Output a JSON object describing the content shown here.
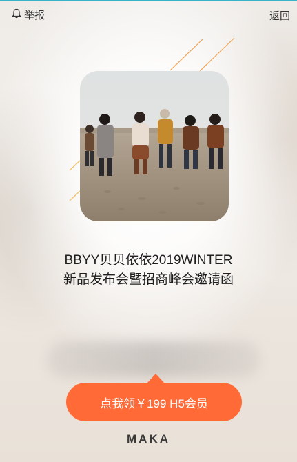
{
  "header": {
    "report_label": "举报",
    "back_label": "返回"
  },
  "content": {
    "title_line1": "BBYY贝贝依依2019WINTER",
    "title_line2": "新品发布会暨招商峰会邀请函"
  },
  "cta": {
    "label": "点我领￥199 H5会员"
  },
  "footer": {
    "logo_text": "MAKA"
  },
  "colors": {
    "accent": "#ff6a37",
    "top_line": "#36b3c9",
    "deco_lines": "#f0a050"
  },
  "icons": {
    "report": "bell-icon"
  }
}
